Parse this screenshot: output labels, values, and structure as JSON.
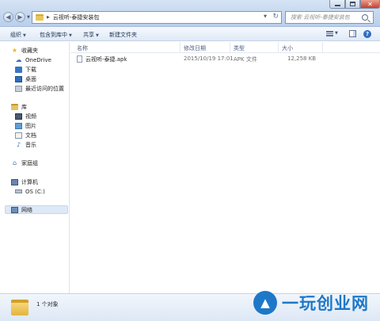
{
  "window": {
    "address_path": "云视听-泰捷安装包",
    "search_placeholder": "搜索 云视听-泰捷安装包",
    "close_glyph": "✕"
  },
  "toolbar": {
    "organize": "组织",
    "include_in_library": "包含到库中",
    "share": "共享",
    "new_folder": "新建文件夹",
    "help_glyph": "?"
  },
  "sidebar": {
    "favorites": {
      "label": "收藏夹",
      "items": [
        {
          "label": "OneDrive",
          "icon": "onedrive-icon"
        },
        {
          "label": "下载",
          "icon": "downloads-folder-icon"
        },
        {
          "label": "桌面",
          "icon": "desktop-icon"
        },
        {
          "label": "最近访问的位置",
          "icon": "recent-places-icon"
        }
      ]
    },
    "libraries": {
      "label": "库",
      "items": [
        {
          "label": "视频",
          "icon": "videos-icon"
        },
        {
          "label": "图片",
          "icon": "pictures-icon"
        },
        {
          "label": "文档",
          "icon": "documents-icon"
        },
        {
          "label": "音乐",
          "icon": "music-icon"
        }
      ]
    },
    "homegroup": {
      "label": "家庭组"
    },
    "computer": {
      "label": "计算机",
      "items": [
        {
          "label": "OS (C:)",
          "icon": "drive-icon"
        }
      ]
    },
    "network": {
      "label": "网络"
    }
  },
  "columns": {
    "name": "名称",
    "date_modified": "修改日期",
    "type": "类型",
    "size": "大小"
  },
  "files": [
    {
      "name": "云视听-泰捷.apk",
      "date_modified": "2015/10/19 17:01",
      "type": "APK 文件",
      "size": "12,258 KB"
    }
  ],
  "status": {
    "item_count": "1 个对象"
  },
  "watermark": {
    "text": "一玩创业网"
  }
}
